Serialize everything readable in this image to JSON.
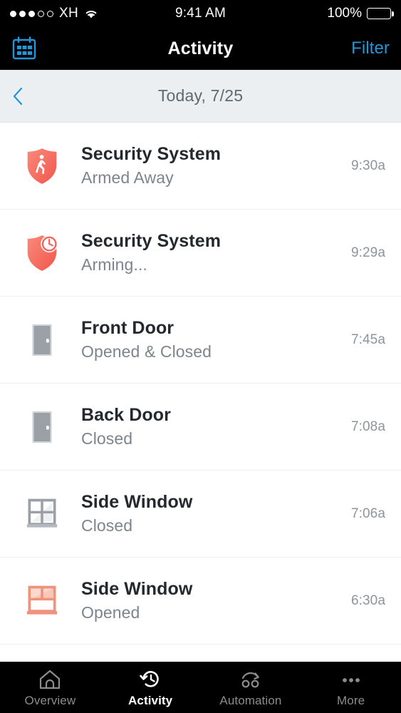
{
  "status_bar": {
    "signal_filled": 3,
    "signal_total": 5,
    "carrier": "XH",
    "wifi_icon": "wifi-icon",
    "time": "9:41 AM",
    "battery_percent": "100%",
    "battery_level": 100
  },
  "nav_bar": {
    "left_icon": "calendar-icon",
    "title": "Activity",
    "action_label": "Filter",
    "action_color": "#2196dd"
  },
  "date_bar": {
    "back_icon": "chevron-left-icon",
    "label": "Today, 7/25"
  },
  "colors": {
    "accent_blue": "#2196dd",
    "alert_red": "#f46055",
    "alert_red_light": "#f58a7d",
    "device_gray": "#9aa0a6",
    "bar_black": "#000000",
    "date_bar_bg": "#eceff1"
  },
  "activity": [
    {
      "icon": "shield-walking-person-icon",
      "icon_kind": "shield-away",
      "title": "Security System",
      "subtitle": "Armed Away",
      "time": "9:30a"
    },
    {
      "icon": "shield-clock-icon",
      "icon_kind": "shield-arming",
      "title": "Security System",
      "subtitle": "Arming...",
      "time": "9:29a"
    },
    {
      "icon": "door-closed-icon",
      "icon_kind": "door-gray",
      "title": "Front Door",
      "subtitle": "Opened & Closed",
      "time": "7:45a"
    },
    {
      "icon": "door-closed-icon",
      "icon_kind": "door-gray",
      "title": "Back Door",
      "subtitle": "Closed",
      "time": "7:08a"
    },
    {
      "icon": "window-closed-icon",
      "icon_kind": "window-gray",
      "title": "Side Window",
      "subtitle": "Closed",
      "time": "7:06a"
    },
    {
      "icon": "window-opened-icon",
      "icon_kind": "window-orange",
      "title": "Side Window",
      "subtitle": "Opened",
      "time": "6:30a"
    }
  ],
  "tab_bar": {
    "tabs": [
      {
        "icon": "home-icon",
        "label": "Overview",
        "active": false
      },
      {
        "icon": "history-clock-icon",
        "label": "Activity",
        "active": true
      },
      {
        "icon": "automation-icon",
        "label": "Automation",
        "active": false
      },
      {
        "icon": "ellipsis-icon",
        "label": "More",
        "active": false
      }
    ]
  }
}
